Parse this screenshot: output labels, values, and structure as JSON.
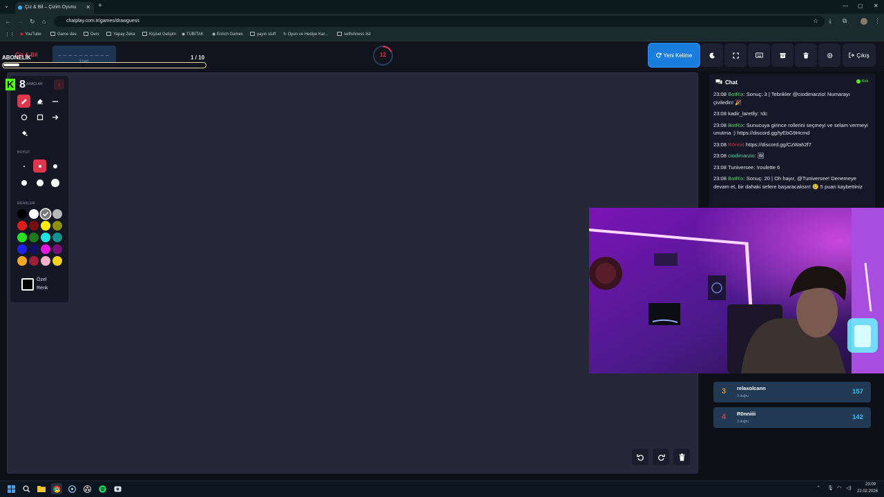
{
  "browser": {
    "tab_title": "Çiz & Bil – Çizim Oyunu",
    "url": "chatplay.com.tr/games/drawguess",
    "bookmarks": [
      "YouTube",
      "Game dev.",
      "Ders",
      "Yapay Zeka",
      "Kişisel Gelişim",
      "TÜBİTAK",
      "Enrich Games",
      "yayın stuff",
      "Oyun ve Hediye Kar...",
      "selfishness list"
    ]
  },
  "header": {
    "brand": "Çiz & Bil",
    "word_blanks": "_ _ _ _ _ _ _ _ _ _",
    "word_hint": "9 harf",
    "round": "1  / 10",
    "timer": "12",
    "new_word_label": "Yeni Kelime",
    "exit_label": "Çıkış",
    "header_icons": [
      "moon-icon",
      "fullscreen-icon",
      "keyboard-icon",
      "archive-icon",
      "trash-icon",
      "gear-icon"
    ]
  },
  "overlay": {
    "subscription_label": "ABONELİK",
    "subscription_progress": 0.08,
    "kick_count": "8"
  },
  "toolbox": {
    "tools_label": "ARAÇLAR",
    "tools": [
      "pencil-icon",
      "eraser-icon",
      "line-icon",
      "circle-icon",
      "square-icon",
      "arrow-icon",
      "fill-icon"
    ],
    "size_label": "BOYUT",
    "color_label": "RENKLER",
    "colors": [
      "#000000",
      "#ffffff",
      "#7a7a7a",
      "#b8b8b8",
      "#e01b1b",
      "#7a0d0d",
      "#ffee00",
      "#8b8f12",
      "#29e21d",
      "#1f7a1a",
      "#1fe3e3",
      "#12938d",
      "#1e22e6",
      "#101060",
      "#e913e3",
      "#7a0f7a",
      "#f5a623",
      "#a11d3a",
      "#f6b3c8",
      "#f2d21b"
    ],
    "selected_color": "#7a7a7a",
    "custom_color_label": "Özel Renk"
  },
  "chat": {
    "title": "Chat",
    "platform": "Kick",
    "messages": [
      {
        "time": "23:08",
        "user": "BotRix",
        "text": ": Sonuç: 3 | Tebrikler @ciodimarzio! Numarayı çiviledin! 🎉"
      },
      {
        "time": "23:08",
        "user": "kadir_laretlly",
        "text": ": !dc"
      },
      {
        "time": "23:08",
        "user": "BotRix",
        "text": ": Sunucuya girince rollerini seçmeyi ve selam vermeyi unutma :) https://discord.gg/tyEbG9Hcmd"
      },
      {
        "time": "23:08",
        "user": "R0nnii",
        "text": ": https://discord.gg/CzWah2f7"
      },
      {
        "time": "23:08",
        "user": "ciodimarzio",
        "text": ": 🖼"
      },
      {
        "time": "23:08",
        "user": "Tuniversee",
        "text": ": !roulette 6"
      },
      {
        "time": "23:08",
        "user": "BotRix",
        "text": ": Sonuç: 20 | Oh hayır, @Tuniversee! Denemeye devam et, bir dahaki sefere başaracaksın! 😢 5 puan kaybettiniz"
      }
    ]
  },
  "scoreboard": [
    {
      "rank": "3",
      "name": "relaxolcann",
      "sub": "3 doğru",
      "points": "157",
      "rank_color": "#e08a2a"
    },
    {
      "rank": "4",
      "name": "R0nniiii",
      "sub": "3 doğru",
      "points": "142",
      "rank_color": "#e0364d"
    }
  ],
  "taskbar": {
    "time": "23:09",
    "date": "22.02.2026"
  }
}
